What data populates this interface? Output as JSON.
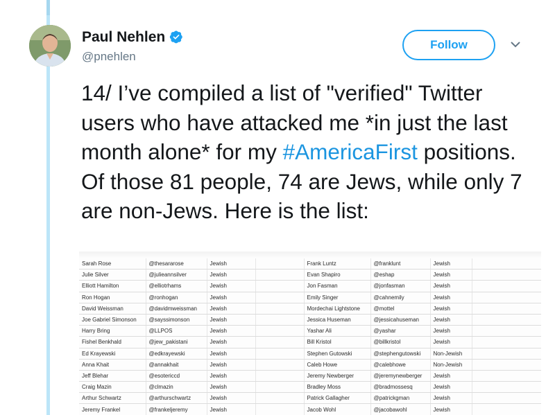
{
  "user": {
    "name": "Paul Nehlen",
    "handle": "@pnehlen"
  },
  "follow_label": "Follow",
  "tweet": {
    "before_hashtag": "14/ I’ve compiled a list of \"verified\" Twitter users who have attacked me *in just the last month alone* for my ",
    "hashtag": "#AmericaFirst",
    "after_hashtag": " positions. Of those 81 people, 74 are Jews, while only 7 are non-Jews. Here is the list:"
  },
  "sheet": {
    "left": [
      [
        "Sarah Rose",
        "@thesararose",
        "Jewish"
      ],
      [
        "Julie Silver",
        "@julieannsilver",
        "Jewish"
      ],
      [
        "Elliott Hamilton",
        "@elliotrhams",
        "Jewish"
      ],
      [
        "Ron Hogan",
        "@ronhogan",
        "Jewish"
      ],
      [
        "David Weissman",
        "@davidmweissman",
        "Jewish"
      ],
      [
        "Joe Gabriel Simonson",
        "@sayssimonson",
        "Jewish"
      ],
      [
        "Harry Bring",
        "@LLPOS",
        "Jewish"
      ],
      [
        "Fishel Benkhald",
        "@jew_pakistani",
        "Jewish"
      ],
      [
        "Ed Krayewski",
        "@edkrayewski",
        "Jewish"
      ],
      [
        "Anna Khait",
        "@annakhait",
        "Jewish"
      ],
      [
        "Jeff Blehar",
        "@esotericcd",
        "Jewish"
      ],
      [
        "Craig Mazin",
        "@clmazin",
        "Jewish"
      ],
      [
        "Arthur Schwartz",
        "@arthurschwartz",
        "Jewish"
      ],
      [
        "Jeremy Frankel",
        "@frankeljeremy",
        "Jewish"
      ]
    ],
    "right": [
      [
        "Frank Luntz",
        "@franklunt",
        "Jewish"
      ],
      [
        "Evan Shapiro",
        "@eshap",
        "Jewish"
      ],
      [
        "Jon Fasman",
        "@jonfasman",
        "Jewish"
      ],
      [
        "Emily Singer",
        "@cahnemily",
        "Jewish"
      ],
      [
        "Mordechai Lightstone",
        "@mottel",
        "Jewish"
      ],
      [
        "Jessica Huseman",
        "@jessicahuseman",
        "Jewish"
      ],
      [
        "Yashar Ali",
        "@yashar",
        "Jewish"
      ],
      [
        "Bill Kristol",
        "@billkristol",
        "Jewish"
      ],
      [
        "Stephen Gutowski",
        "@stephengutowski",
        "Non-Jewish"
      ],
      [
        "Caleb Howe",
        "@calebhowe",
        "Non-Jewish"
      ],
      [
        "Jeremy Newberger",
        "@jeremynewberger",
        "Jewish"
      ],
      [
        "Bradley Moss",
        "@bradmossesq",
        "Jewish"
      ],
      [
        "Patrick Gallagher",
        "@patrickgman",
        "Jewish"
      ],
      [
        "Jacob Wohl",
        "@jacobawohl",
        "Jewish"
      ]
    ]
  }
}
